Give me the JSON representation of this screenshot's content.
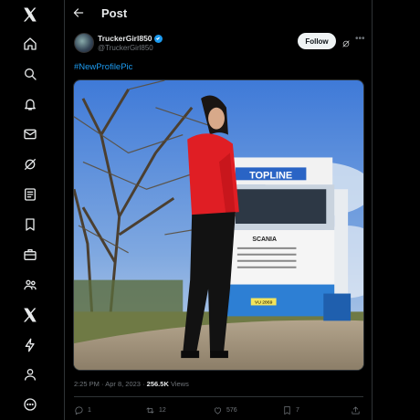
{
  "header": {
    "title": "Post"
  },
  "post": {
    "display_name": "TruckerGirl850",
    "handle": "@TruckerGirl850",
    "follow_label": "Follow",
    "text": "#NewProfilePic",
    "image_texts": {
      "truck_banner": "TOPLINE",
      "grille_brand": "SCANIA",
      "plate": "VU 2869"
    },
    "time": "2:25 PM",
    "date": "Apr 8, 2023",
    "views_count": "256.5K",
    "views_label": "Views",
    "replies": "1",
    "reposts": "12",
    "likes": "576",
    "bookmarks": "7"
  },
  "sidebar": {
    "icons": [
      "x-logo-icon",
      "home-icon",
      "search-icon",
      "notifications-icon",
      "messages-icon",
      "grok-icon",
      "lists-icon",
      "bookmarks-icon",
      "jobs-icon",
      "communities-icon",
      "premium-icon",
      "verified-orgs-icon",
      "profile-icon",
      "more-icon"
    ]
  },
  "colors": {
    "accent": "#1d9bf0",
    "background": "#000000",
    "text": "#e7e9ea",
    "muted": "#71767b"
  }
}
